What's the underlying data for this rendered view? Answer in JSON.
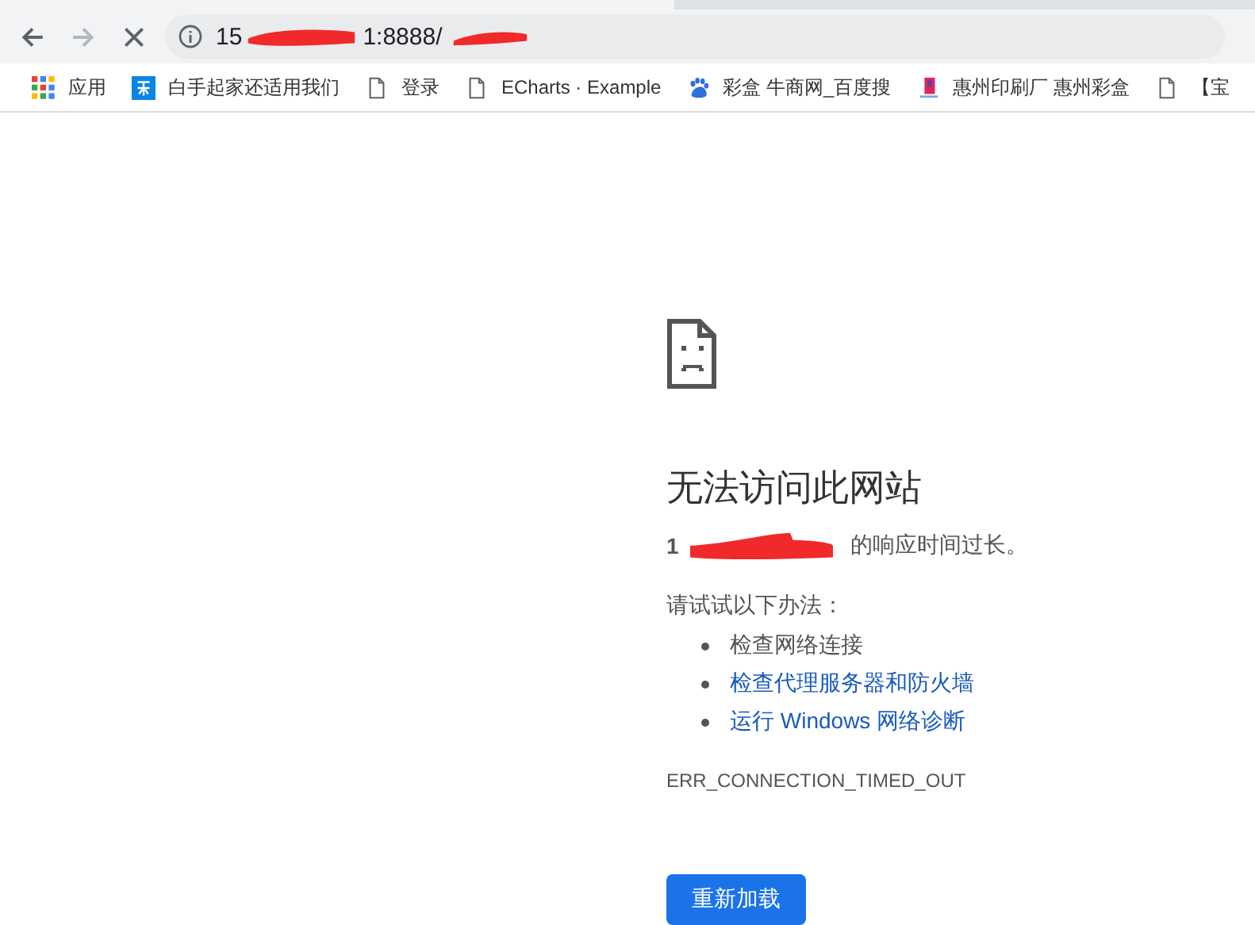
{
  "toolbar": {
    "url_parts": [
      "15",
      "1:8888/"
    ]
  },
  "bookmarks": [
    {
      "kind": "apps",
      "label": "应用"
    },
    {
      "kind": "zhihu",
      "label": "白手起家还适用我们"
    },
    {
      "kind": "page",
      "label": "登录"
    },
    {
      "kind": "page",
      "label": "ECharts · Example"
    },
    {
      "kind": "paw",
      "label": "彩盒 牛商网_百度搜"
    },
    {
      "kind": "logo",
      "label": "惠州印刷厂 惠州彩盒"
    },
    {
      "kind": "page",
      "label": "【宝"
    }
  ],
  "error": {
    "title": "无法访问此网站",
    "host_visible": "1",
    "message": "的响应时间过长。",
    "suggestion_intro": "请试试以下办法：",
    "suggestions": [
      {
        "text": "检查网络连接",
        "link": false
      },
      {
        "text": "检查代理服务器和防火墙",
        "link": true
      },
      {
        "text": "运行 Windows 网络诊断",
        "link": true
      }
    ],
    "code": "ERR_CONNECTION_TIMED_OUT",
    "button": "重新加载"
  }
}
